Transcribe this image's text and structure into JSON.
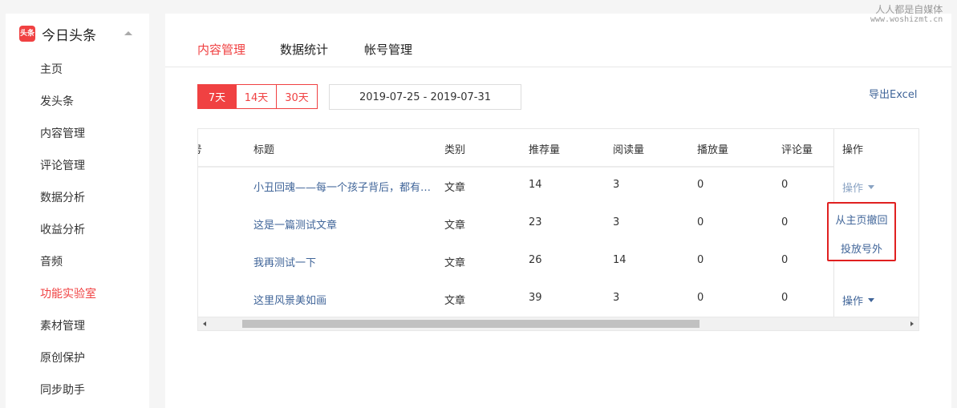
{
  "brand": {
    "logo_text": "头条",
    "name": "今日头条"
  },
  "sidebar": {
    "items": [
      {
        "label": "主页"
      },
      {
        "label": "发头条"
      },
      {
        "label": "内容管理"
      },
      {
        "label": "评论管理"
      },
      {
        "label": "数据分析"
      },
      {
        "label": "收益分析"
      },
      {
        "label": "音频"
      },
      {
        "label": "功能实验室",
        "active": true
      },
      {
        "label": "素材管理"
      },
      {
        "label": "原创保护"
      },
      {
        "label": "同步助手"
      }
    ]
  },
  "tabs": [
    {
      "label": "内容管理",
      "active": true
    },
    {
      "label": "数据统计"
    },
    {
      "label": "帐号管理"
    }
  ],
  "filters": {
    "ranges": [
      {
        "label": "7天",
        "active": true
      },
      {
        "label": "14天"
      },
      {
        "label": "30天"
      }
    ],
    "date_range": "2019-07-25 - 2019-07-31",
    "export_label": "导出Excel"
  },
  "table": {
    "columns": [
      "标题",
      "类别",
      "推荐量",
      "阅读量",
      "播放量",
      "评论量"
    ],
    "action_header": "操作",
    "rows": [
      {
        "title": "小丑回魂——每一个孩子背后，都有一个故事",
        "category": "文章",
        "recommend": "14",
        "read": "3",
        "play": "0",
        "comment": "0"
      },
      {
        "title": "这是一篇测试文章",
        "category": "文章",
        "recommend": "23",
        "read": "3",
        "play": "0",
        "comment": "0"
      },
      {
        "title": "我再测试一下",
        "category": "文章",
        "recommend": "26",
        "read": "14",
        "play": "0",
        "comment": "0"
      },
      {
        "title": "这里风景美如画",
        "category": "文章",
        "recommend": "39",
        "read": "3",
        "play": "0",
        "comment": "0"
      }
    ],
    "action_label": "操作"
  },
  "dropdown": {
    "items": [
      {
        "label": "从主页撤回"
      },
      {
        "label": "投放号外"
      }
    ]
  },
  "watermark": {
    "line1": "人人都是自媒体",
    "line2": "www.woshizmt.cn"
  },
  "colors": {
    "accent": "#f04142",
    "link": "#406599",
    "highlight_border": "#e02020"
  }
}
